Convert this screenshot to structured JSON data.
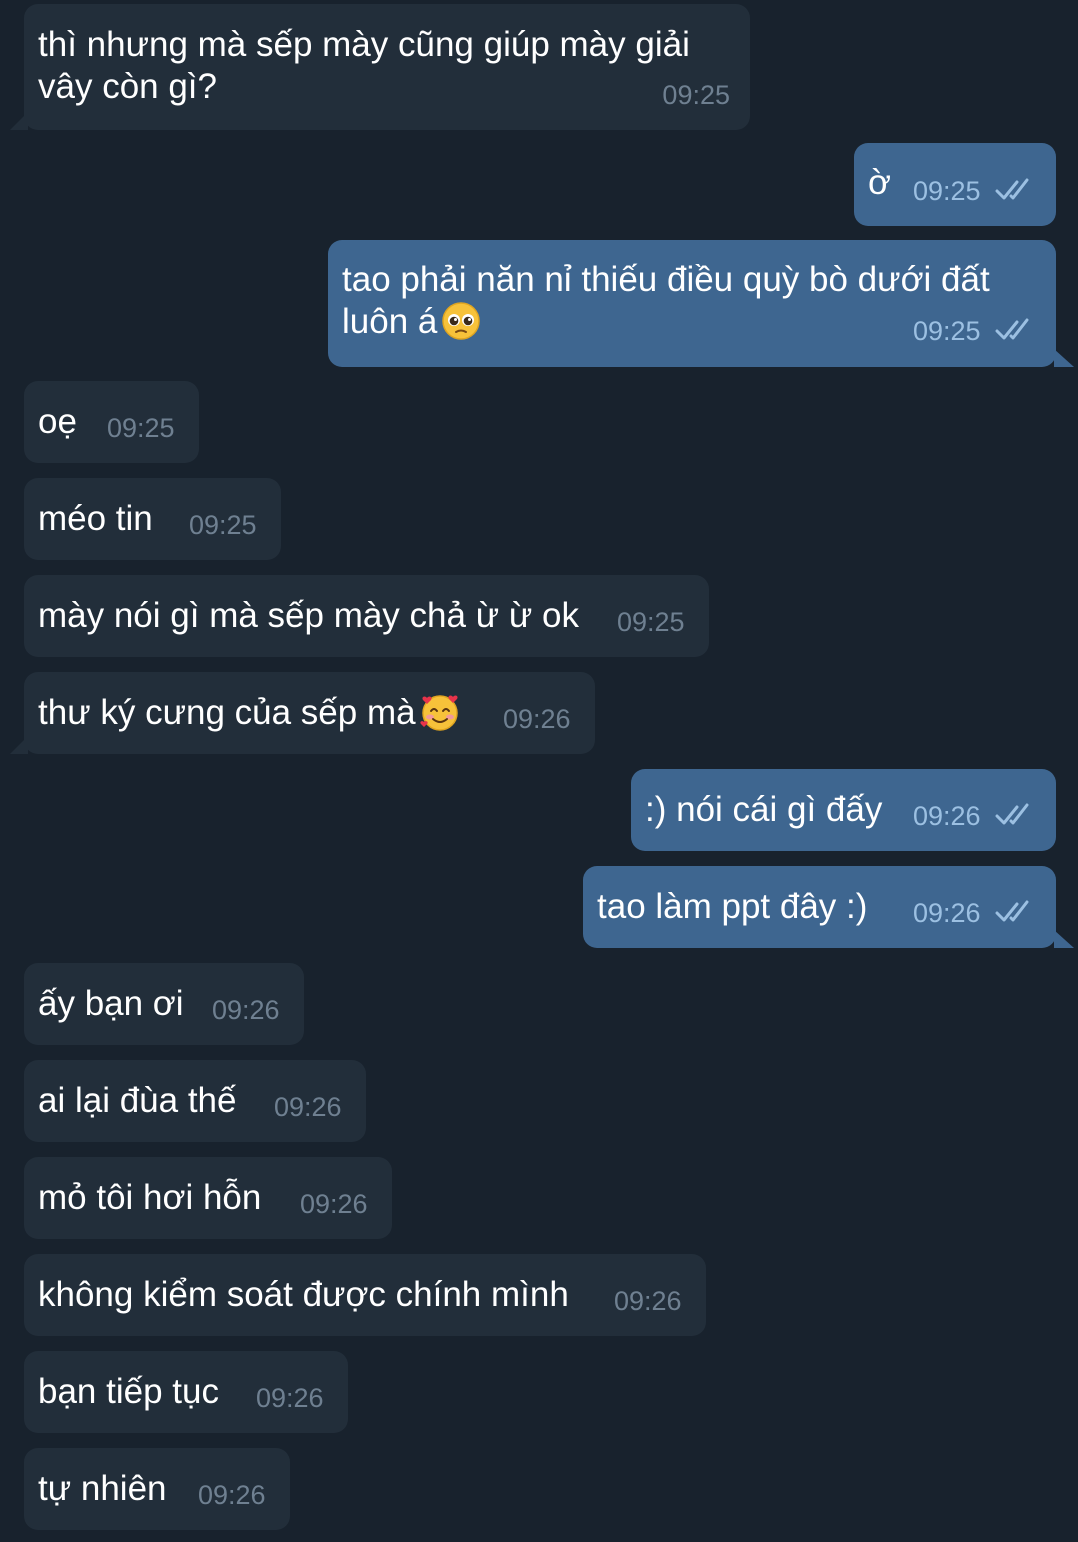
{
  "messages": [
    {
      "text": "thì nhưng mà sếp mày cũng giúp mày giải vây còn gì?",
      "time": "09:25",
      "direction": "in"
    },
    {
      "text": "ờ",
      "time": "09:25",
      "direction": "out",
      "read": true
    },
    {
      "text": "tao phải năn nỉ thiếu điều quỳ bò dưới đất luôn á",
      "time": "09:25",
      "direction": "out",
      "read": true,
      "emoji": "pleading-face"
    },
    {
      "text": "oẹ",
      "time": "09:25",
      "direction": "in"
    },
    {
      "text": "méo tin",
      "time": "09:25",
      "direction": "in"
    },
    {
      "text": "mày nói gì mà sếp mày chả ừ ừ ok",
      "time": "09:25",
      "direction": "in"
    },
    {
      "text": "thư ký cưng của sếp mà",
      "time": "09:26",
      "direction": "in",
      "emoji": "smiling-face-with-hearts"
    },
    {
      "text": ":) nói cái gì đấy",
      "time": "09:26",
      "direction": "out",
      "read": true
    },
    {
      "text": "tao làm ppt đây :)",
      "time": "09:26",
      "direction": "out",
      "read": true
    },
    {
      "text": "ấy bạn ơi",
      "time": "09:26",
      "direction": "in"
    },
    {
      "text": "ai lại đùa thế",
      "time": "09:26",
      "direction": "in"
    },
    {
      "text": "mỏ tôi hơi hỗn",
      "time": "09:26",
      "direction": "in"
    },
    {
      "text": "không kiểm soát được chính mình",
      "time": "09:26",
      "direction": "in"
    },
    {
      "text": "bạn tiếp tục",
      "time": "09:26",
      "direction": "in"
    },
    {
      "text": "tự nhiên",
      "time": "09:26",
      "direction": "in"
    }
  ],
  "colors": {
    "background": "#18222d",
    "incoming_bubble": "#222e3a",
    "outgoing_bubble": "#3e6690",
    "incoming_time": "#6f8091",
    "outgoing_time": "#9cc0e2"
  },
  "icons": {
    "read_status": "double-check-icon"
  }
}
